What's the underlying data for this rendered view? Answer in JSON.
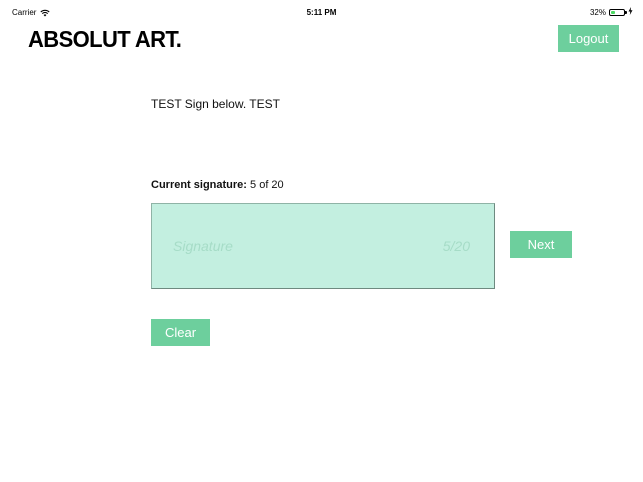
{
  "status_bar": {
    "carrier": "Carrier",
    "time": "5:11 PM",
    "battery": "32%",
    "battery_level": 0.32
  },
  "header": {
    "logo": "ABSOLUT ART.",
    "logout_label": "Logout"
  },
  "main": {
    "instructions": "TEST Sign below. TEST",
    "current_signature_label": "Current signature:",
    "current_signature_value": "5 of 20",
    "signature_placeholder": "Signature",
    "signature_counter": "5/20",
    "next_label": "Next",
    "clear_label": "Clear"
  },
  "colors": {
    "accent": "#6dcf9d",
    "signature_bg": "#c3efe0"
  },
  "icons": [
    "wifi-icon",
    "battery-icon",
    "charging-icon"
  ]
}
